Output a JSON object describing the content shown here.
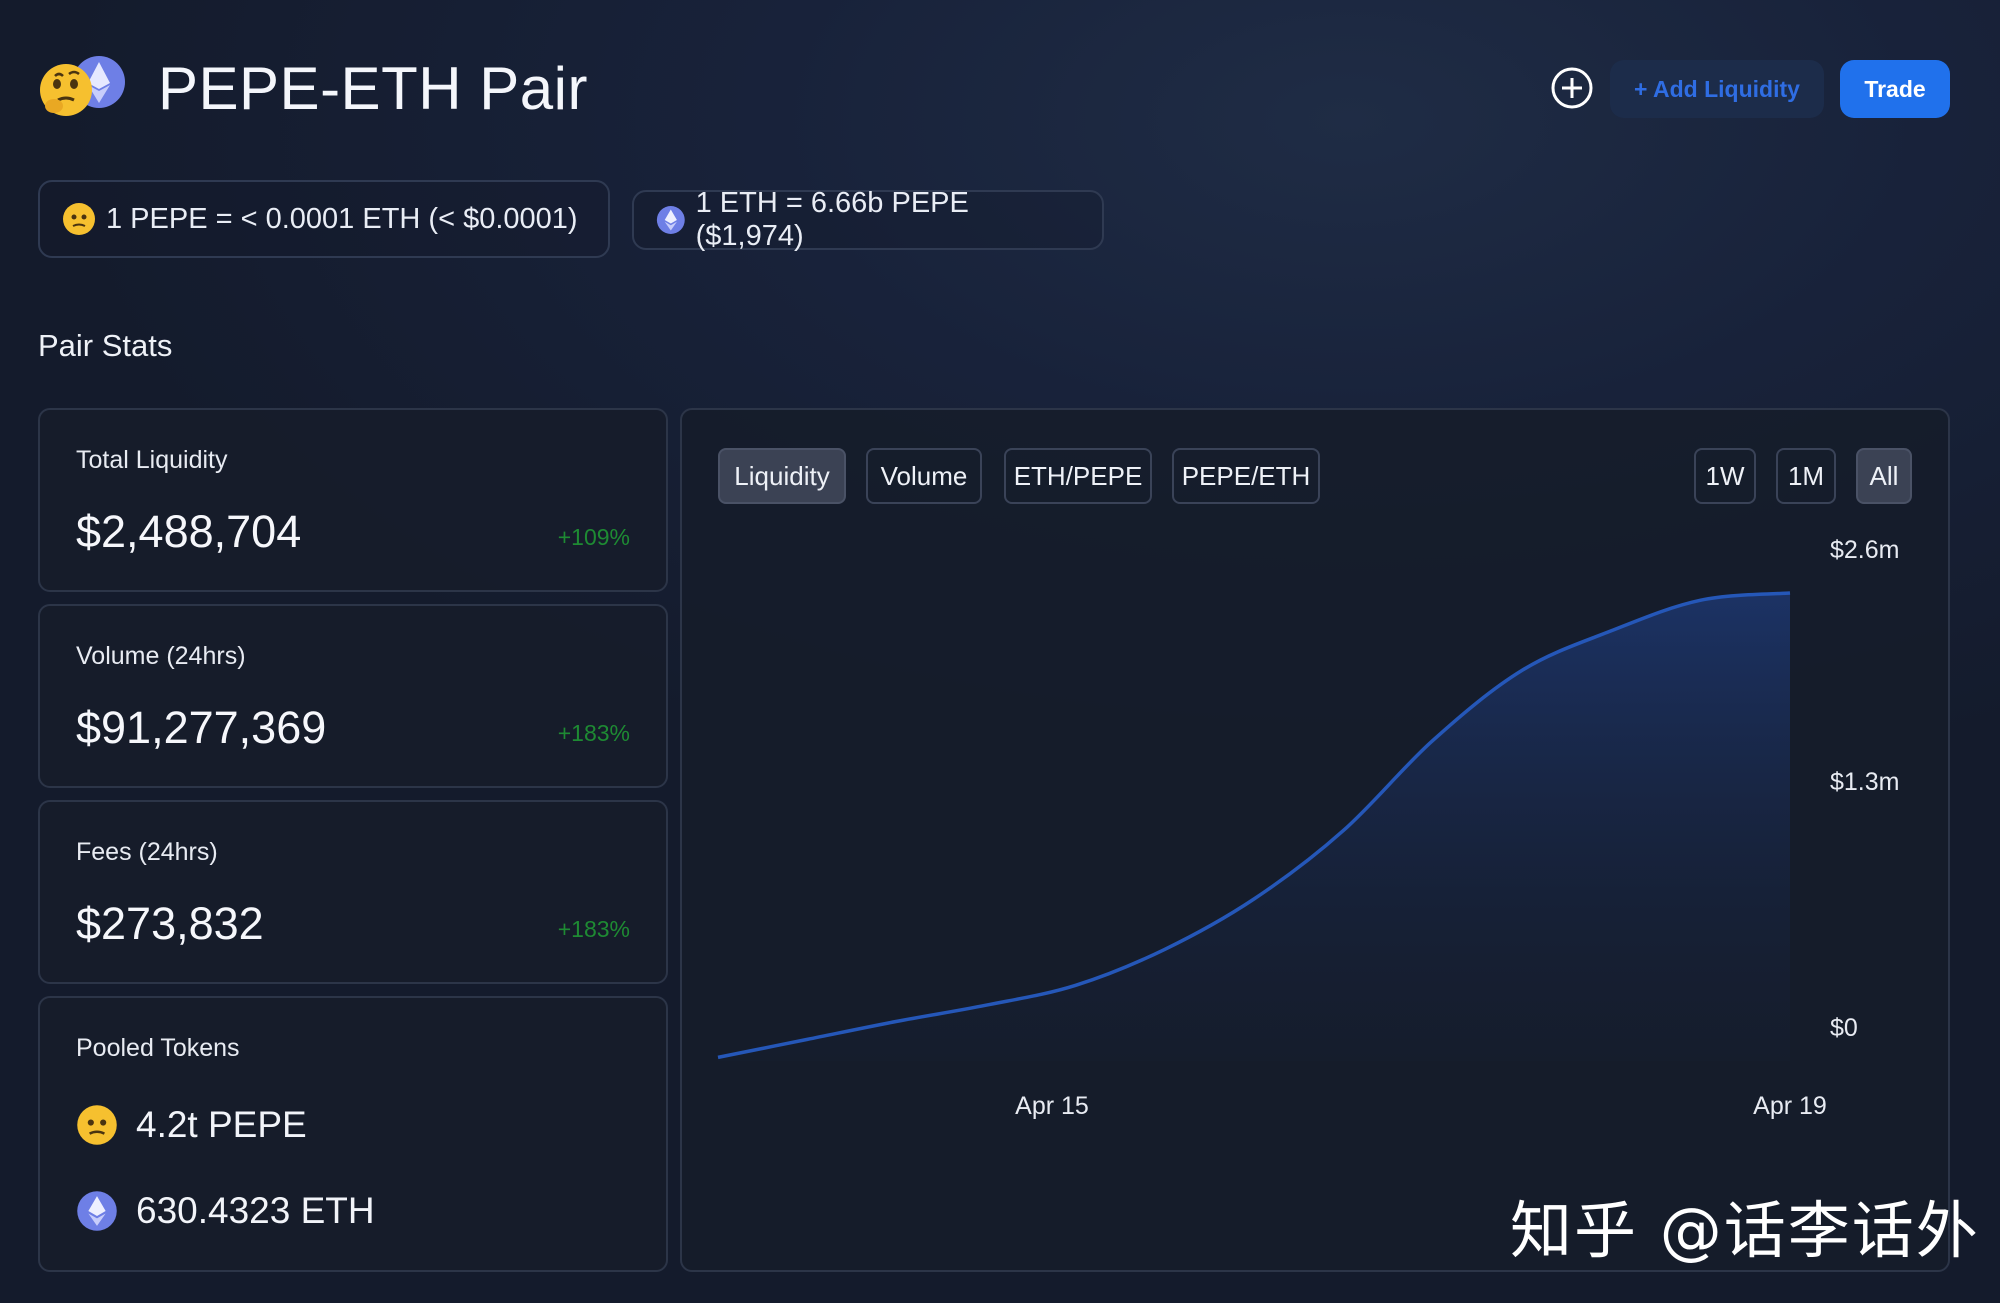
{
  "header": {
    "title": "PEPE-ETH Pair",
    "pair_icon": "pepe-eth-pair-icon",
    "add_icon": "plus-circle-icon",
    "add_liquidity_label": "+ Add Liquidity",
    "trade_label": "Trade"
  },
  "prices": [
    {
      "icon": "pepe-token-icon",
      "text": "1 PEPE = < 0.0001 ETH (< $0.0001)"
    },
    {
      "icon": "eth-token-icon",
      "text": "1 ETH = 6.66b PEPE ($1,974)"
    }
  ],
  "stats": {
    "section_title": "Pair Stats",
    "total_liquidity": {
      "label": "Total Liquidity",
      "value": "$2,488,704",
      "change": "+109%"
    },
    "volume": {
      "label": "Volume (24hrs)",
      "value": "$91,277,369",
      "change": "+183%"
    },
    "fees": {
      "label": "Fees (24hrs)",
      "value": "$273,832",
      "change": "+183%"
    },
    "pooled": {
      "label": "Pooled Tokens",
      "tokens": [
        {
          "icon": "pepe-token-icon",
          "amount": "4.2t PEPE"
        },
        {
          "icon": "eth-token-icon",
          "amount": "630.4323 ETH"
        }
      ]
    }
  },
  "chart_tabs": [
    "Liquidity",
    "Volume",
    "ETH/PEPE",
    "PEPE/ETH"
  ],
  "active_tab": "Liquidity",
  "range_tabs": [
    "1W",
    "1M",
    "All"
  ],
  "active_range": "All",
  "colors": {
    "accent": "#2071ec",
    "positive": "#1e8a33",
    "line": "#2557b8"
  },
  "chart_data": {
    "type": "area",
    "title": "",
    "xlabel": "",
    "ylabel": "",
    "x_tick_labels": [
      "Apr 15",
      "Apr 19"
    ],
    "y_tick_labels": [
      "$2.6m",
      "$1.3m",
      "$0"
    ],
    "ylim": [
      0,
      2.6
    ],
    "y_unit": "millions USD",
    "x_days": [
      13.0,
      13.5,
      14.0,
      14.5,
      15.0,
      15.5,
      16.0,
      16.5,
      17.0,
      17.5,
      18.0,
      18.5,
      19.0
    ],
    "values": [
      0.02,
      0.12,
      0.22,
      0.31,
      0.42,
      0.62,
      0.9,
      1.28,
      1.78,
      2.17,
      2.39,
      2.56,
      2.6
    ],
    "grid": false,
    "legend": "none"
  },
  "watermark": "知乎 @话李话外"
}
